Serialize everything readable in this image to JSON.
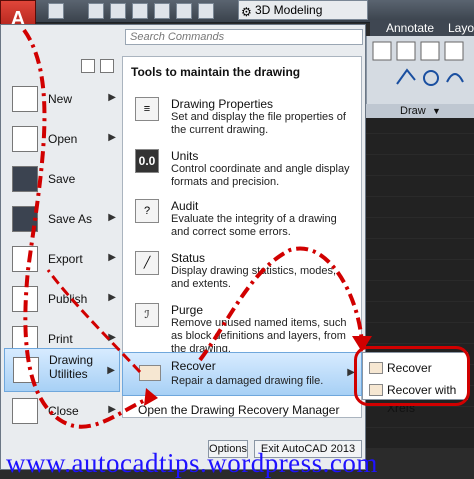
{
  "app_button": {
    "label": "A"
  },
  "workspace": {
    "label": "3D Modeling"
  },
  "ribbon": {
    "tabs": [
      "Annotate",
      "Layo"
    ],
    "panel_footer": "Draw"
  },
  "search": {
    "placeholder": "Search Commands"
  },
  "left_menu": [
    {
      "label": "New",
      "has_arrow": true
    },
    {
      "label": "Open",
      "has_arrow": true
    },
    {
      "label": "Save",
      "has_arrow": false
    },
    {
      "label": "Save As",
      "has_arrow": true
    },
    {
      "label": "Export",
      "has_arrow": true
    },
    {
      "label": "Publish",
      "has_arrow": true
    },
    {
      "label": "Print",
      "has_arrow": true
    },
    {
      "label": "Drawing Utilities",
      "has_arrow": true
    },
    {
      "label": "Close",
      "has_arrow": true
    }
  ],
  "tools": {
    "title": "Tools to maintain the drawing",
    "items": [
      {
        "name": "Drawing Properties",
        "desc": "Set and display the file properties of the current drawing."
      },
      {
        "name": "Units",
        "icon_text": "0.0",
        "desc": "Control coordinate and angle display formats and precision."
      },
      {
        "name": "Audit",
        "desc": "Evaluate the integrity of a drawing and correct some errors."
      },
      {
        "name": "Status",
        "desc": "Display drawing statistics, modes, and extents."
      },
      {
        "name": "Purge",
        "desc": "Remove unused named items, such as block definitions and layers, from the drawing."
      }
    ],
    "recover": {
      "name": "Recover",
      "desc": "Repair a damaged drawing file."
    },
    "drawing_recovery_manager": "Open the Drawing Recovery Manager"
  },
  "submenu": {
    "items": [
      "Recover",
      "Recover with Xrefs"
    ]
  },
  "bottom_buttons": {
    "options": "Options",
    "exit": "Exit AutoCAD 2013"
  },
  "watermark": "www.autocadtips.wordpress.com",
  "colors": {
    "accent_red": "#d10000",
    "highlight_blue": "#a7d0f5",
    "watermark_blue": "#1f12ff"
  }
}
